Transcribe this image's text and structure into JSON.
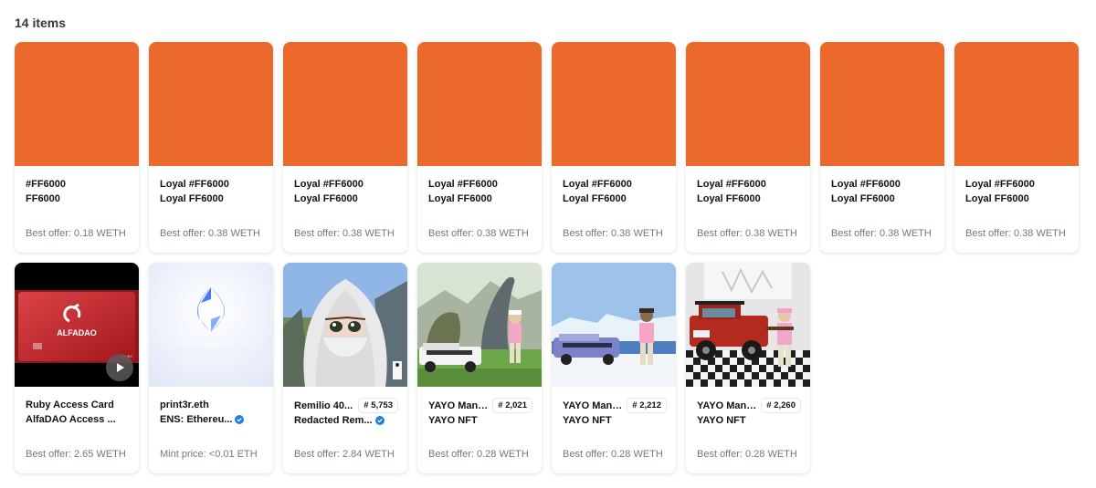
{
  "header": {
    "count": "14 items"
  },
  "colors": {
    "orange": "#EB6A2B",
    "muted": "#707a83",
    "verified": "#2081e2"
  },
  "cards": [
    {
      "name": "#FF6000",
      "collection": "FF6000",
      "price": "Best offer: 0.18 WETH",
      "image": "orange-swatch"
    },
    {
      "name": "Loyal #FF6000",
      "collection": "Loyal FF6000",
      "price": "Best offer: 0.38 WETH",
      "image": "orange-swatch"
    },
    {
      "name": "Loyal #FF6000",
      "collection": "Loyal FF6000",
      "price": "Best offer: 0.38 WETH",
      "image": "orange-swatch"
    },
    {
      "name": "Loyal #FF6000",
      "collection": "Loyal FF6000",
      "price": "Best offer: 0.38 WETH",
      "image": "orange-swatch"
    },
    {
      "name": "Loyal #FF6000",
      "collection": "Loyal FF6000",
      "price": "Best offer: 0.38 WETH",
      "image": "orange-swatch"
    },
    {
      "name": "Loyal #FF6000",
      "collection": "Loyal FF6000",
      "price": "Best offer: 0.38 WETH",
      "image": "orange-swatch"
    },
    {
      "name": "Loyal #FF6000",
      "collection": "Loyal FF6000",
      "price": "Best offer: 0.38 WETH",
      "image": "orange-swatch"
    },
    {
      "name": "Loyal #FF6000",
      "collection": "Loyal FF6000",
      "price": "Best offer: 0.38 WETH",
      "image": "orange-swatch"
    },
    {
      "name": "Ruby Access Card",
      "collection": "AlfaDAO Access ...",
      "price": "Best offer: 2.65 WETH",
      "image": "red-access-card",
      "card_logo_text": "ALFADAO",
      "card_small_text": "RUBY",
      "video": true
    },
    {
      "name": "print3r.eth",
      "collection": "ENS: Ethereu...",
      "price": "Mint price: <0.01 ETH",
      "image": "ens-logo",
      "image_text": "Content not available yet",
      "verified": true
    },
    {
      "name": "Remilio 40...",
      "collection": "Redacted Rem...",
      "price": "Best offer: 2.84 WETH",
      "image": "anime-veiled-character",
      "token": "# 5,753",
      "verified": true
    },
    {
      "name": "YAYO Man ...",
      "collection": "YAYO NFT",
      "price": "Best offer: 0.28 WETH",
      "image": "pixel-limo-dinosaur",
      "token": "# 2,021"
    },
    {
      "name": "YAYO Man ...",
      "collection": "YAYO NFT",
      "price": "Best offer: 0.28 WETH",
      "image": "pixel-limo-iceberg",
      "token": "# 2,212"
    },
    {
      "name": "YAYO Man ...",
      "collection": "YAYO NFT",
      "price": "Best offer: 0.28 WETH",
      "image": "pixel-red-truck",
      "token": "# 2,260"
    }
  ]
}
